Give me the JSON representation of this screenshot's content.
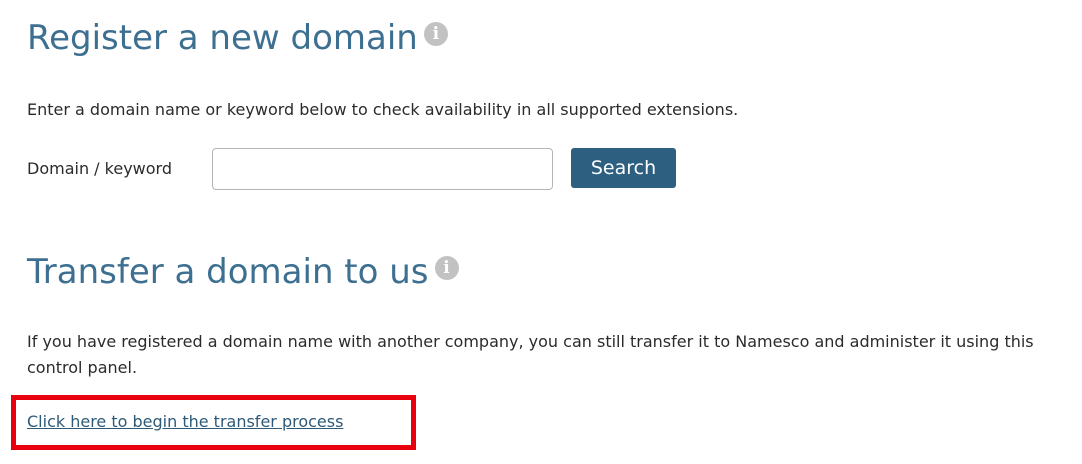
{
  "register": {
    "heading": "Register a new domain",
    "info_icon": "info-icon",
    "description": "Enter a domain name or keyword below to check availability in all supported extensions.",
    "field_label": "Domain / keyword",
    "field_value": "",
    "search_label": "Search"
  },
  "transfer": {
    "heading": "Transfer a domain to us",
    "info_icon": "info-icon",
    "description": "If you have registered a domain name with another company, you can still transfer it to Namesco and administer it using this control panel.",
    "link_text": "Click here to begin the transfer process"
  },
  "colors": {
    "heading": "#3d6f91",
    "button": "#2c5f80",
    "link": "#2e5a78",
    "highlight": "#e8000e",
    "info_icon": "#c2c2c2"
  }
}
